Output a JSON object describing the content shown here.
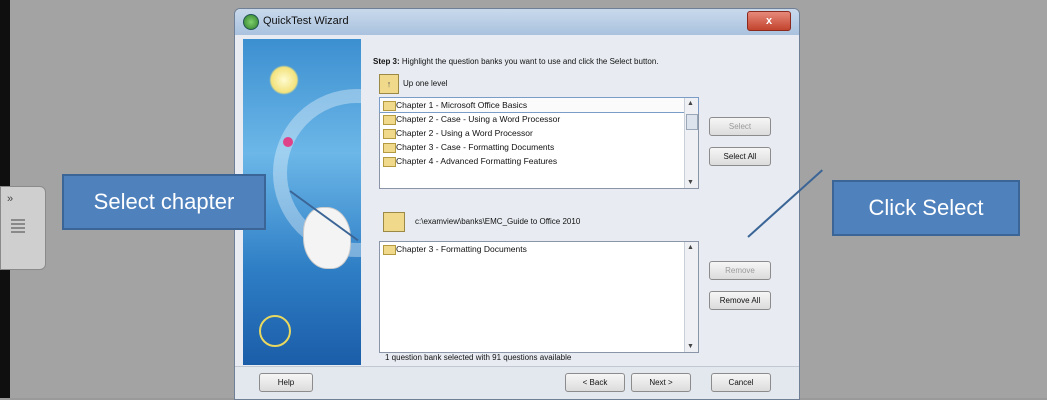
{
  "window": {
    "title": "QuickTest Wizard",
    "close_glyph": "x"
  },
  "step": {
    "label": "Step 3:",
    "instruction": "Highlight the question banks you want to use and click the Select button.",
    "up_level": "Up one level"
  },
  "available_banks": [
    "Chapter 1 - Microsoft Office Basics",
    "Chapter 2 - Case - Using a Word Processor",
    "Chapter 2 - Using a Word Processor",
    "Chapter 3 - Case - Formatting Documents",
    "Chapter 4 - Advanced Formatting Features"
  ],
  "path": "c:\\examview\\banks\\EMC_Guide to Office 2010",
  "selected_banks": [
    "Chapter 3 - Formatting Documents"
  ],
  "buttons": {
    "select": "Select",
    "select_all": "Select All",
    "remove": "Remove",
    "remove_all": "Remove All",
    "help": "Help",
    "back": "< Back",
    "next": "Next >",
    "cancel": "Cancel"
  },
  "summary": "1 question bank selected with 91 questions available",
  "callouts": {
    "left": "Select chapter",
    "right": "Click Select"
  },
  "side_tab": {
    "arrows": "»"
  },
  "icons": [
    "app-icon",
    "close-icon",
    "up-folder-icon",
    "folder-icon",
    "scroll-up-icon",
    "scroll-down-icon"
  ],
  "colors": {
    "callout": "#4f81bd",
    "close": "#c2442e",
    "titlebar": "#a9c2de"
  }
}
